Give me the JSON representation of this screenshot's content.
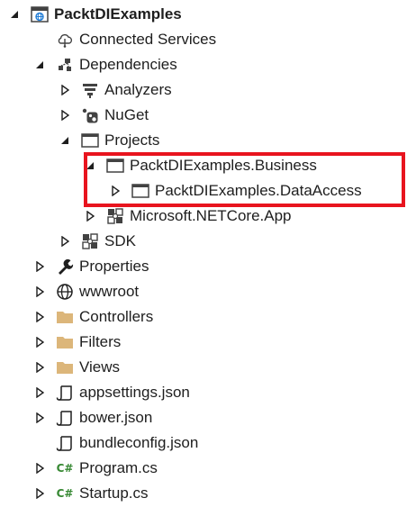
{
  "tree": [
    {
      "id": "project",
      "label": "PacktDIExamples",
      "bold": true,
      "arrow": "expanded",
      "icon": "web-project-icon",
      "level": 0
    },
    {
      "id": "connected-services",
      "label": "Connected Services",
      "arrow": "none",
      "icon": "connected-services-icon",
      "level": 1
    },
    {
      "id": "dependencies",
      "label": "Dependencies",
      "arrow": "expanded",
      "icon": "dependencies-icon",
      "level": 1
    },
    {
      "id": "analyzers",
      "label": "Analyzers",
      "arrow": "collapsed",
      "icon": "analyzers-icon",
      "level": 2
    },
    {
      "id": "nuget",
      "label": "NuGet",
      "arrow": "collapsed",
      "icon": "nuget-icon",
      "level": 2
    },
    {
      "id": "projects",
      "label": "Projects",
      "arrow": "expanded",
      "icon": "project-reference-icon",
      "level": 2
    },
    {
      "id": "business",
      "label": "PacktDIExamples.Business",
      "arrow": "expanded",
      "icon": "project-reference-icon",
      "level": 3
    },
    {
      "id": "dataaccess",
      "label": "PacktDIExamples.DataAccess",
      "arrow": "collapsed",
      "icon": "project-reference-icon",
      "level": 4
    },
    {
      "id": "netcore-app",
      "label": "Microsoft.NETCore.App",
      "arrow": "collapsed",
      "icon": "sdk-icon",
      "level": 3
    },
    {
      "id": "sdk",
      "label": "SDK",
      "arrow": "collapsed",
      "icon": "sdk-icon",
      "level": 2
    },
    {
      "id": "properties",
      "label": "Properties",
      "arrow": "collapsed",
      "icon": "wrench-icon",
      "level": 1
    },
    {
      "id": "wwwroot",
      "label": "wwwroot",
      "arrow": "collapsed",
      "icon": "globe-icon",
      "level": 1
    },
    {
      "id": "controllers",
      "label": "Controllers",
      "arrow": "collapsed",
      "icon": "folder-icon",
      "level": 1
    },
    {
      "id": "filters",
      "label": "Filters",
      "arrow": "collapsed",
      "icon": "folder-icon",
      "level": 1
    },
    {
      "id": "views",
      "label": "Views",
      "arrow": "collapsed",
      "icon": "folder-icon",
      "level": 1
    },
    {
      "id": "appsettings",
      "label": "appsettings.json",
      "arrow": "collapsed",
      "icon": "json-file-icon",
      "level": 1
    },
    {
      "id": "bower",
      "label": "bower.json",
      "arrow": "collapsed",
      "icon": "json-file-icon",
      "level": 1
    },
    {
      "id": "bundleconfig",
      "label": "bundleconfig.json",
      "arrow": "none",
      "icon": "json-file-icon",
      "level": 1
    },
    {
      "id": "program",
      "label": "Program.cs",
      "arrow": "collapsed",
      "icon": "csharp-file-icon",
      "level": 1
    },
    {
      "id": "startup",
      "label": "Startup.cs",
      "arrow": "collapsed",
      "icon": "csharp-file-icon",
      "level": 1
    }
  ],
  "colors": {
    "highlight": "#e8141e",
    "folder": "#dcb67a",
    "csharp": "#368832",
    "globe": "#1e7bd6"
  },
  "csharp_glyph": "C#"
}
